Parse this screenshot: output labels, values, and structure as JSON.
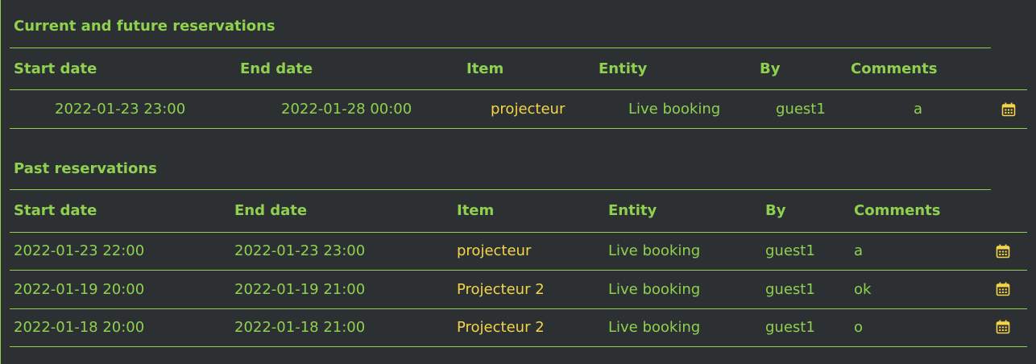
{
  "current": {
    "title": "Current and future reservations",
    "headers": {
      "start": "Start date",
      "end": "End date",
      "item": "Item",
      "entity": "Entity",
      "by": "By",
      "comments": "Comments"
    },
    "rows": [
      {
        "start": "2022-01-23 23:00",
        "end": "2022-01-28 00:00",
        "item": "projecteur",
        "entity": "Live booking",
        "by": "guest1",
        "comments": "a"
      }
    ]
  },
  "past": {
    "title": "Past reservations",
    "headers": {
      "start": "Start date",
      "end": "End date",
      "item": "Item",
      "entity": "Entity",
      "by": "By",
      "comments": "Comments"
    },
    "rows": [
      {
        "start": "2022-01-23 22:00",
        "end": "2022-01-23 23:00",
        "item": "projecteur",
        "entity": "Live booking",
        "by": "guest1",
        "comments": "a"
      },
      {
        "start": "2022-01-19 20:00",
        "end": "2022-01-19 21:00",
        "item": "Projecteur 2",
        "entity": "Live booking",
        "by": "guest1",
        "comments": "ok"
      },
      {
        "start": "2022-01-18 20:00",
        "end": "2022-01-18 21:00",
        "item": "Projecteur 2",
        "entity": "Live booking",
        "by": "guest1",
        "comments": "o"
      }
    ]
  },
  "icons": {
    "row_action": "calendar-icon"
  },
  "colors": {
    "background": "#2c3033",
    "accent": "#8fd14f",
    "item": "#f5d547"
  }
}
